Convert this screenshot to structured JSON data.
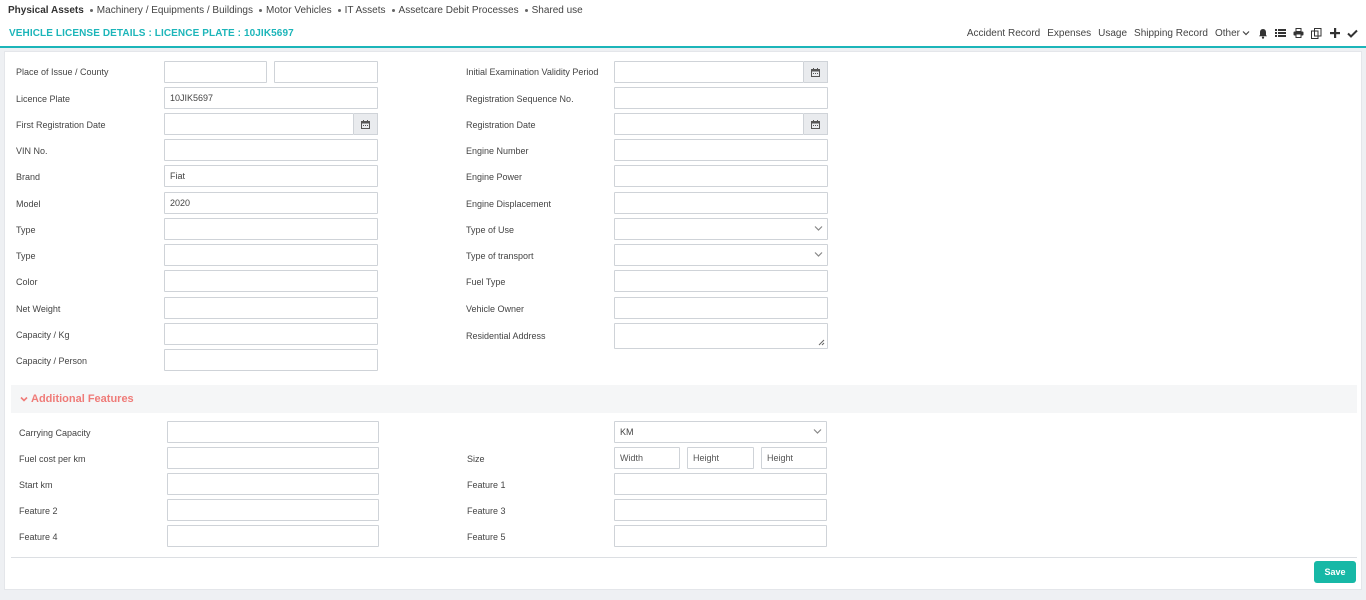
{
  "topnav": [
    "Physical Assets",
    "Machinery / Equipments / Buildings",
    "Motor Vehicles",
    "IT Assets",
    "Assetcare Debit Processes",
    "Shared use"
  ],
  "header": {
    "title": "VEHICLE LICENSE DETAILS : LICENCE PLATE : 10JIK5697",
    "actions": [
      "Accident Record",
      "Expenses",
      "Usage",
      "Shipping Record",
      "Other"
    ],
    "icons": [
      "bell-icon",
      "list-icon",
      "print-icon",
      "copy-icon",
      "plus-icon",
      "check-icon"
    ]
  },
  "form_left": {
    "place_of_issue": {
      "label": "Place of Issue / County",
      "value1": "",
      "value2": ""
    },
    "licence_plate": {
      "label": "Licence Plate",
      "value": "10JIK5697"
    },
    "first_registration_date": {
      "label": "First Registration Date",
      "value": "",
      "icon": "calendar-icon"
    },
    "vin": {
      "label": "VIN No.",
      "value": ""
    },
    "brand": {
      "label": "Brand",
      "value": "Fiat"
    },
    "model": {
      "label": "Model",
      "value": "2020"
    },
    "type1": {
      "label": "Type",
      "value": ""
    },
    "type2": {
      "label": "Type",
      "value": ""
    },
    "color": {
      "label": "Color",
      "value": ""
    },
    "net_weight": {
      "label": "Net Weight",
      "value": ""
    },
    "capacity_kg": {
      "label": "Capacity / Kg",
      "value": ""
    },
    "capacity_person": {
      "label": "Capacity / Person",
      "value": ""
    }
  },
  "form_right": {
    "initial_exam": {
      "label": "Initial Examination Validity Period",
      "value": "",
      "icon": "calendar-icon"
    },
    "registration_seq": {
      "label": "Registration Sequence No.",
      "value": ""
    },
    "registration_date": {
      "label": "Registration Date",
      "value": "",
      "icon": "calendar-icon"
    },
    "engine_number": {
      "label": "Engine Number",
      "value": ""
    },
    "engine_power": {
      "label": "Engine Power",
      "value": ""
    },
    "engine_displacement": {
      "label": "Engine Displacement",
      "value": ""
    },
    "type_of_use": {
      "label": "Type of Use",
      "value": ""
    },
    "type_of_transport": {
      "label": "Type of transport",
      "value": ""
    },
    "fuel_type": {
      "label": "Fuel Type",
      "value": ""
    },
    "vehicle_owner": {
      "label": "Vehicle Owner",
      "value": ""
    },
    "residential_address": {
      "label": "Residential Address",
      "value": ""
    }
  },
  "additional": {
    "title": "Additional Features",
    "carrying_capacity": {
      "label": "Carrying Capacity",
      "value": ""
    },
    "unit_select": {
      "value": "KM"
    },
    "fuel_cost": {
      "label": "Fuel cost per km",
      "value": ""
    },
    "size": {
      "label": "Size",
      "width_ph": "Width",
      "height_ph": "Height",
      "height2_ph": "Height"
    },
    "start_km": {
      "label": "Start km",
      "value": ""
    },
    "feature1": {
      "label": "Feature 1",
      "value": ""
    },
    "feature2": {
      "label": "Feature 2",
      "value": ""
    },
    "feature3": {
      "label": "Feature 3",
      "value": ""
    },
    "feature4": {
      "label": "Feature 4",
      "value": ""
    },
    "feature5": {
      "label": "Feature 5",
      "value": ""
    }
  },
  "save_label": "Save",
  "colors": {
    "accent": "#1cb5b9",
    "section_title": "#ef7b78",
    "save": "#17b8a6"
  }
}
